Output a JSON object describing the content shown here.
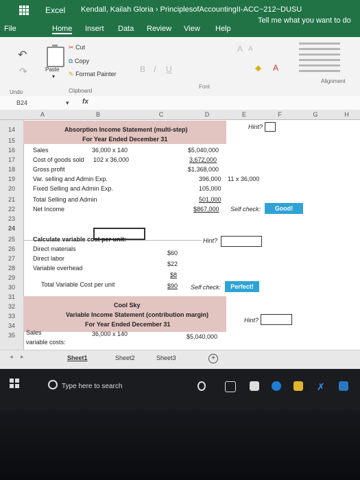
{
  "app": {
    "name": "Excel",
    "document": "Kendall, Kailah Gloria  ›  PrinciplesofAccountingII-ACC~212~DUSU"
  },
  "tabs": [
    "File",
    "Home",
    "Insert",
    "Data",
    "Review",
    "View",
    "Help"
  ],
  "tell_me": "Tell me what you want to do",
  "ribbon": {
    "paste": "Paste",
    "cut": "Cut",
    "copy": "Copy",
    "format_painter": "Format Painter",
    "clipboard": "Clipboard",
    "undo": "Undo",
    "font": "Font",
    "alignment": "Alignment"
  },
  "formula_bar": {
    "name_box": "B24",
    "fx": "fx"
  },
  "columns": [
    "A",
    "B",
    "C",
    "D",
    "E",
    "F",
    "G",
    "H"
  ],
  "rows": [
    "14",
    "15",
    "16",
    "17",
    "18",
    "19",
    "20",
    "21",
    "22",
    "23",
    "24",
    "25",
    "26",
    "27",
    "28",
    "29",
    "30",
    "31",
    "32",
    "33",
    "34",
    "35"
  ],
  "sheet": {
    "title1": "Absorption Income Statement (multi-step)",
    "period1": "For Year Ended December 31",
    "hint_label": "Hint?",
    "sales_label": "Sales",
    "sales_calc": "36,000 x 140",
    "sales_value": "$5,040,000",
    "cogs_label": "Cost of goods sold",
    "cogs_calc": "102 x 36,000",
    "cogs_value": "3,672,000",
    "gross_label": "Gross profit",
    "gross_value": "$1,368,000",
    "var_label": "Var. selling and Admin Exp.",
    "var_value": "396,000",
    "var_calc": "11 x 36,000",
    "fixed_label": "Fixed Selling and Admin Exp.",
    "fixed_value": "105,000",
    "total_label": "Total Selling and Admin",
    "total_value": "501,000",
    "net_label": "Net Income",
    "net_value": "$867,000",
    "self_check": "Self check:",
    "good": "Good!",
    "calc_heading": "Calculate variable cost per unit:",
    "dm_label": "Direct materials",
    "dm_value": "$60",
    "dl_label": "Direct labor",
    "dl_value": "$22",
    "vo_label": "Variable overhead",
    "vo_value": "$8",
    "tvc_label": "Total Variable Cost per unit",
    "tvc_value": "$90",
    "perfect": "Perfect!",
    "company": "Cool Sky",
    "title2": "Variable Income Statement (contribution margin)",
    "period2": "For Year Ended December 31",
    "sales2_label": "Sales",
    "sales2_calc": "36,000 x 140",
    "sales2_value": "$5,040,000",
    "varcosts_label": "variable costs:"
  },
  "sheet_tabs": [
    "Sheet1",
    "Sheet2",
    "Sheet3"
  ],
  "taskbar": {
    "search_placeholder": "Type here to search"
  },
  "colors": {
    "excel_green": "#217346",
    "header_shade": "#e2c4c0",
    "check_badge": "#2fa3d6"
  }
}
